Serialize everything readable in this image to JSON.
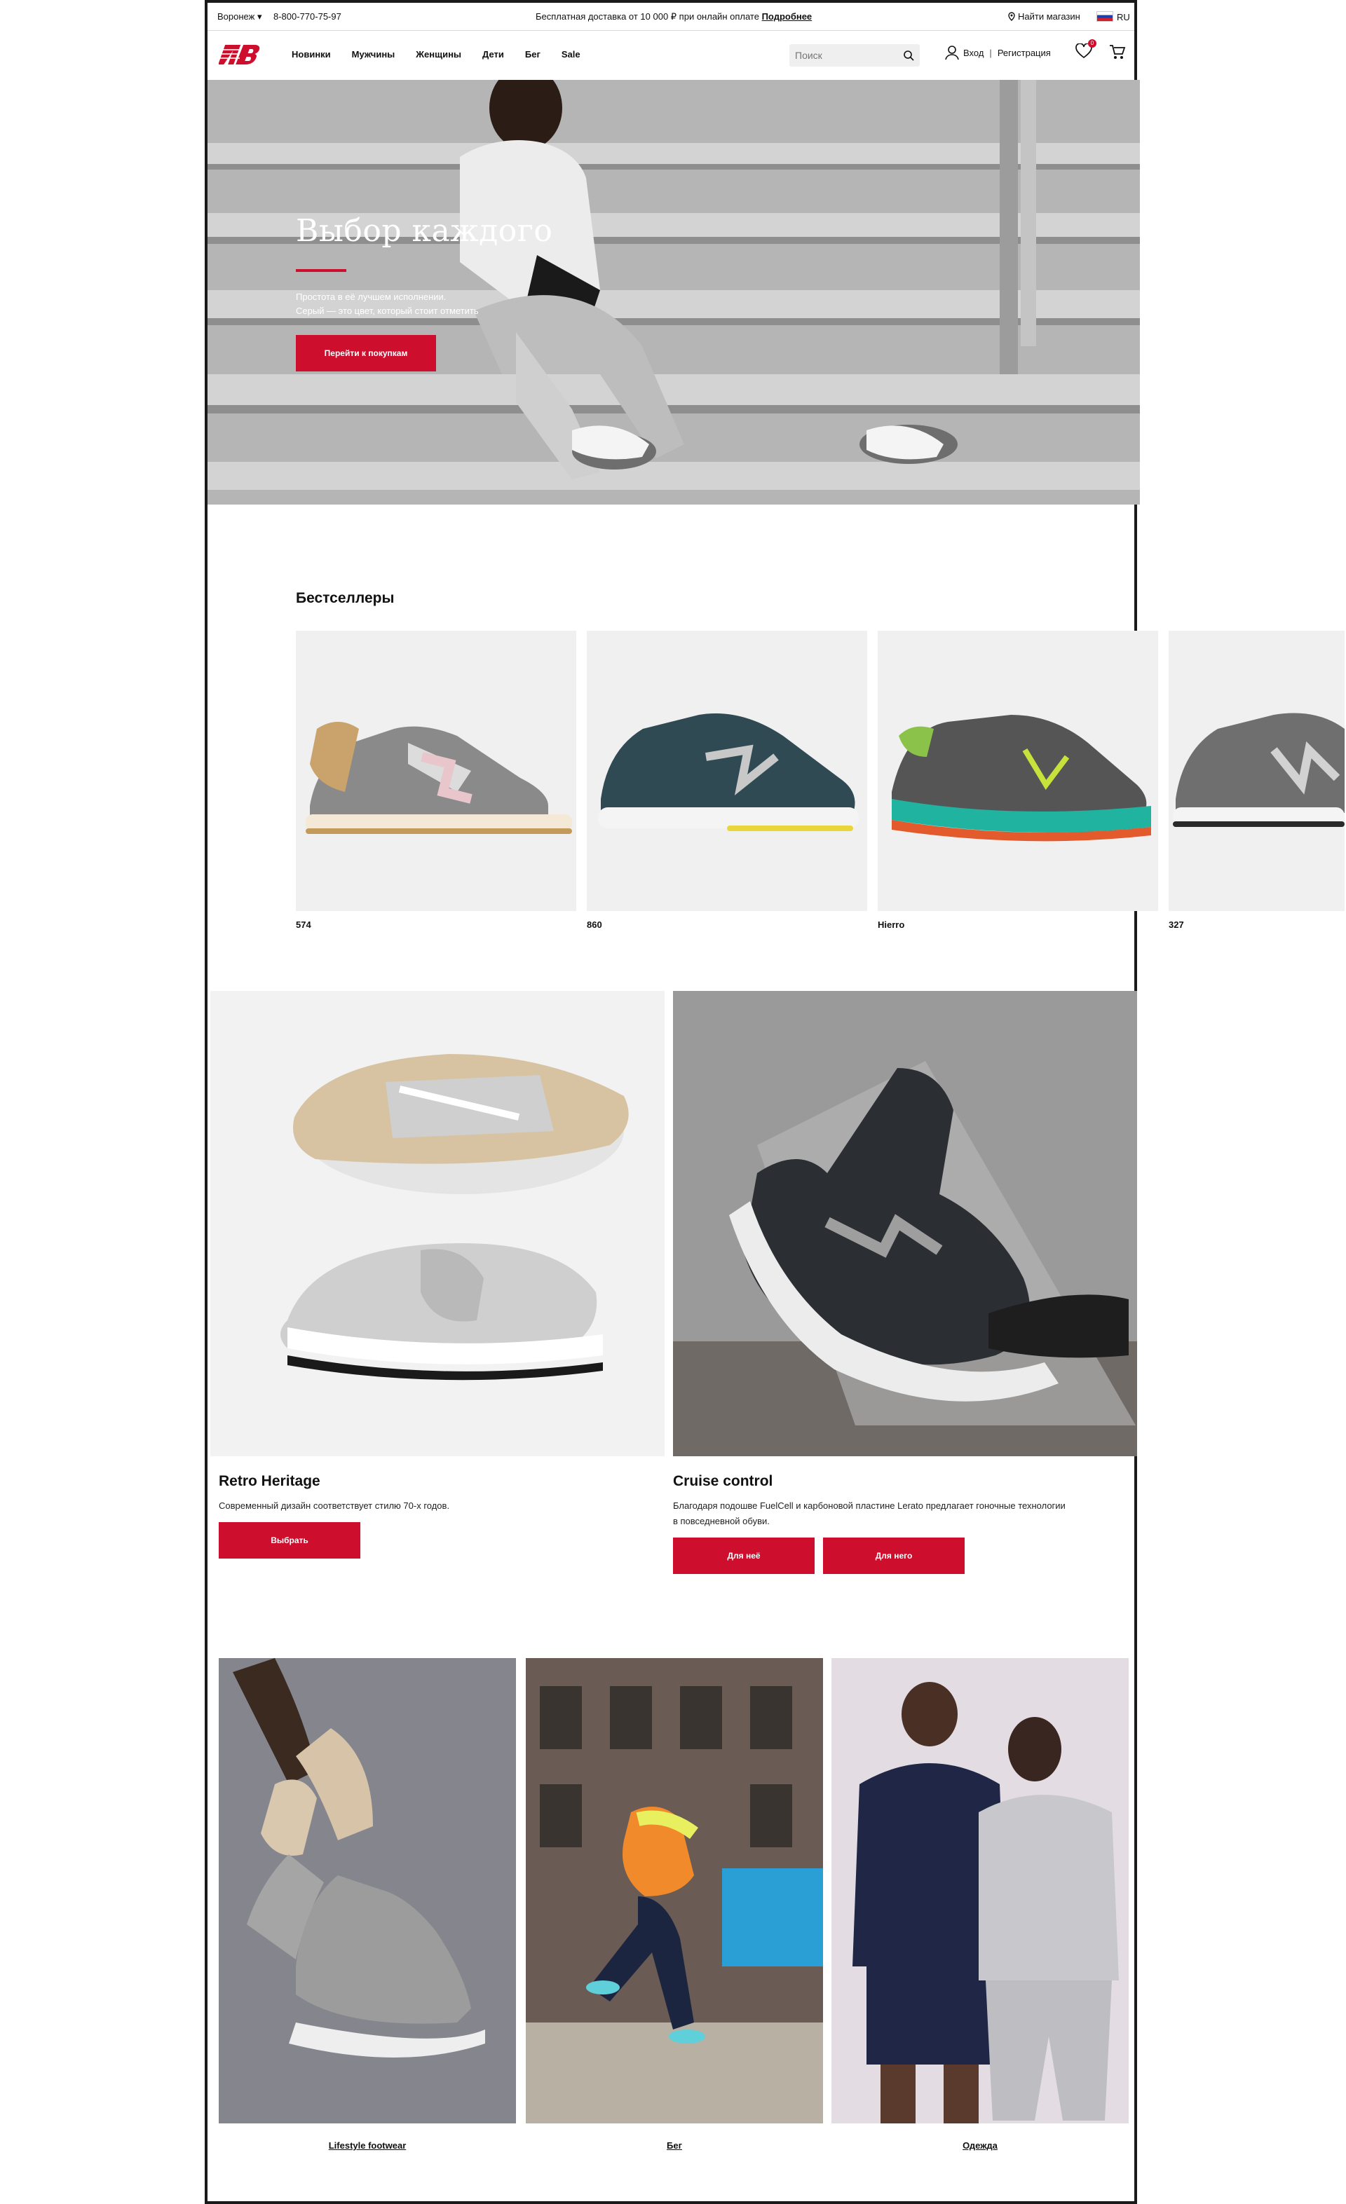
{
  "topbar": {
    "city": "Воронеж",
    "phone": "8-800-770-75-97",
    "promo": "Бесплатная доставка от 10 000 ₽ при онлайн оплате",
    "promo_link": "Подробнее",
    "find_store": "Найти магазин",
    "language": "RU"
  },
  "nav": {
    "items": [
      "Новинки",
      "Мужчины",
      "Женщины",
      "Дети",
      "Бег",
      "Sale"
    ],
    "search_placeholder": "Поиск",
    "login": "Вход",
    "register": "Регистрация",
    "wishlist_count": "0"
  },
  "hero": {
    "title": "Выбор каждого",
    "subtitle_line1": "Простота в её лучшем исполнении.",
    "subtitle_line2": "Серый — это цвет, который стоит отметить",
    "cta": "Перейти к покупкам"
  },
  "bestsellers": {
    "title": "Бестселлеры",
    "items": [
      {
        "name": "574"
      },
      {
        "name": "860"
      },
      {
        "name": "Hierro"
      },
      {
        "name": "327"
      }
    ]
  },
  "features": [
    {
      "title": "Retro Heritage",
      "text": "Современный дизайн соответствует стилю 70-х годов.",
      "buttons": [
        "Выбрать"
      ]
    },
    {
      "title": "Cruise control",
      "text": "Благодаря подошве FuelCell и карбоновой пластине Lerato предлагает гоночные технологии в повседневной обуви.",
      "buttons": [
        "Для неё",
        "Для него"
      ]
    }
  ],
  "categories": [
    {
      "label": "Lifestyle footwear"
    },
    {
      "label": "Бег"
    },
    {
      "label": "Одежда"
    }
  ],
  "colors": {
    "accent": "#ce0e2d",
    "text": "#111111",
    "card_bg": "#f0f0f0"
  }
}
